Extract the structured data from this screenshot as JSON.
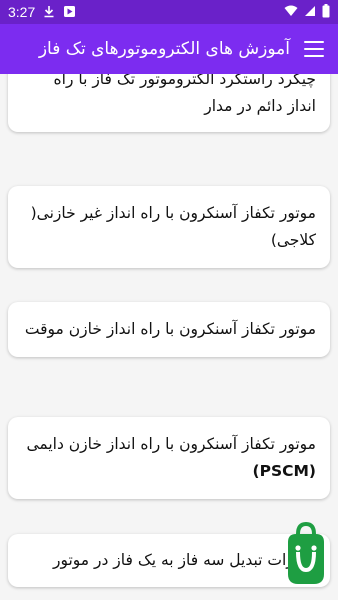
{
  "status": {
    "time": "3:27",
    "icons": [
      "download-icon",
      "play-store-icon",
      "wifi-icon",
      "signal-icon",
      "battery-icon"
    ]
  },
  "app_bar": {
    "title": "آموزش های الکتروموتورهای تک فاز",
    "menu_icon": "hamburger-menu-icon"
  },
  "items": [
    {
      "text": "چیگرد راستگرد الکتروموتور تک فاز با راه انداز دائم در مدار"
    },
    {
      "text": "موتور تکفاز آسنکرون با راه انداز غیر خازنی( کلاجی)"
    },
    {
      "text": "موتور تکفاز آسنکرون با راه انداز خازن موقت"
    },
    {
      "text": "موتور تکفاز آسنکرون با راه انداز خازن دایمی",
      "tag": "(PSCM)"
    },
    {
      "text": "تغییرات تبدیل سه فاز به یک فاز در موتور"
    }
  ],
  "fab": {
    "icon": "bazaar-logo-icon",
    "color": "#1e9e42"
  }
}
